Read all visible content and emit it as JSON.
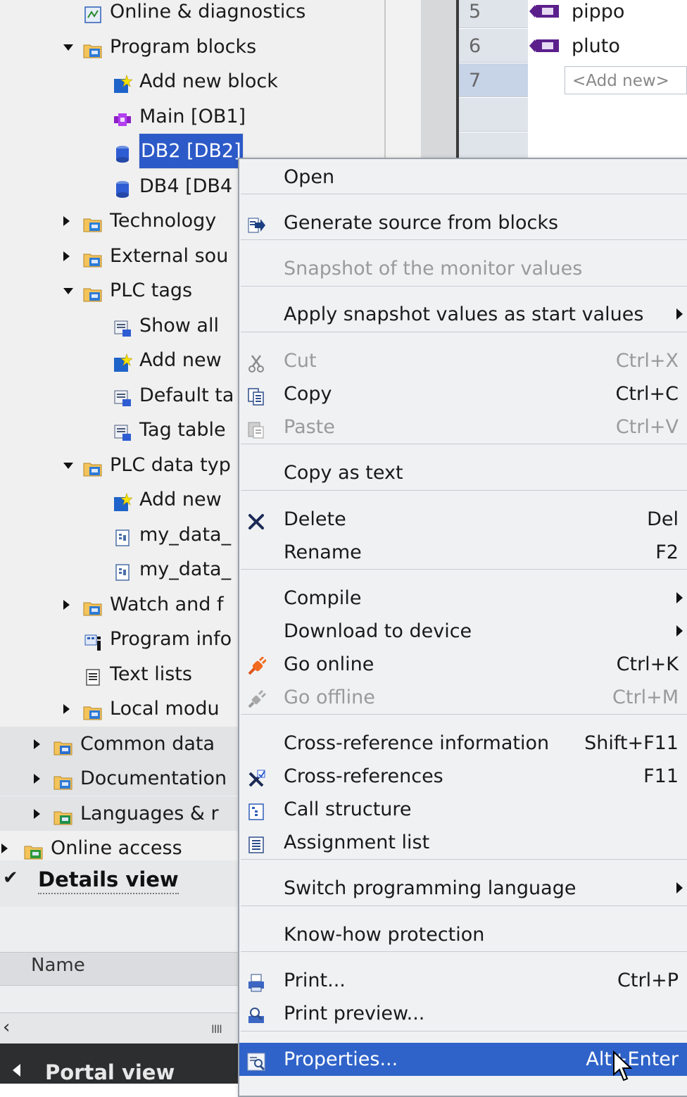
{
  "tree": {
    "items": [
      {
        "label": "Online & diagnostics",
        "icon": "diagnostics-icon",
        "level": 3,
        "expander": "none",
        "band": false
      },
      {
        "label": "Program blocks",
        "icon": "program-blocks-folder-icon",
        "level": 2,
        "expander": "expanded",
        "band": false
      },
      {
        "label": "Add new block",
        "icon": "add-new-star-icon",
        "level": 4,
        "expander": "none",
        "band": false
      },
      {
        "label": "Main [OB1]",
        "icon": "organization-block-icon",
        "level": 4,
        "expander": "none",
        "band": false
      },
      {
        "label": "DB2 [DB2]",
        "icon": "data-block-icon",
        "level": 4,
        "expander": "none",
        "band": false,
        "selected": true
      },
      {
        "label": "DB4 [DB4",
        "icon": "data-block-icon",
        "level": 4,
        "expander": "none",
        "band": false
      },
      {
        "label": "Technology",
        "icon": "technology-folder-icon",
        "level": 2,
        "expander": "collapsed",
        "band": false
      },
      {
        "label": "External sou",
        "icon": "external-source-folder-icon",
        "level": 2,
        "expander": "collapsed",
        "band": false
      },
      {
        "label": "PLC tags",
        "icon": "plc-tags-folder-icon",
        "level": 2,
        "expander": "expanded",
        "band": false
      },
      {
        "label": "Show all",
        "icon": "show-all-tags-icon",
        "level": 4,
        "expander": "none",
        "band": false
      },
      {
        "label": "Add new",
        "icon": "add-new-star-icon",
        "level": 4,
        "expander": "none",
        "band": false
      },
      {
        "label": "Default ta",
        "icon": "default-tag-table-icon",
        "level": 4,
        "expander": "none",
        "band": false
      },
      {
        "label": "Tag table",
        "icon": "tag-table-icon",
        "level": 4,
        "expander": "none",
        "band": false
      },
      {
        "label": "PLC data typ",
        "icon": "plc-data-types-folder-icon",
        "level": 2,
        "expander": "expanded",
        "band": false
      },
      {
        "label": "Add new",
        "icon": "add-new-star-icon",
        "level": 4,
        "expander": "none",
        "band": false
      },
      {
        "label": "my_data_",
        "icon": "data-type-icon",
        "level": 4,
        "expander": "none",
        "band": false
      },
      {
        "label": "my_data_",
        "icon": "data-type-icon",
        "level": 4,
        "expander": "none",
        "band": false
      },
      {
        "label": "Watch and f",
        "icon": "watch-force-folder-icon",
        "level": 2,
        "expander": "collapsed",
        "band": false
      },
      {
        "label": "Program info",
        "icon": "program-info-icon",
        "level": 3,
        "expander": "none",
        "band": false
      },
      {
        "label": "Text lists",
        "icon": "text-list-icon",
        "level": 3,
        "expander": "none",
        "band": false
      },
      {
        "label": "Local modu",
        "icon": "local-modules-folder-icon",
        "level": 2,
        "expander": "collapsed",
        "band": false
      },
      {
        "label": "Common data",
        "icon": "common-data-folder-icon",
        "level": 1,
        "expander": "collapsed",
        "band": true
      },
      {
        "label": "Documentation",
        "icon": "documentation-folder-icon",
        "level": 1,
        "expander": "collapsed",
        "band": true
      },
      {
        "label": "Languages & r",
        "icon": "languages-folder-icon",
        "level": 1,
        "expander": "collapsed",
        "band": true
      },
      {
        "label": "Online access",
        "icon": "online-access-folder-icon",
        "level": 0,
        "expander": "collapsed",
        "band": false
      }
    ]
  },
  "editor": {
    "rows": [
      {
        "num": "5",
        "name": "pippo",
        "current": false
      },
      {
        "num": "6",
        "name": "pluto",
        "current": false
      },
      {
        "num": "7",
        "name": "",
        "current": true
      }
    ],
    "add_new": "<Add new>"
  },
  "details": {
    "title": "Details view",
    "check": "✔",
    "name_column": "Name",
    "scroll_left": "‹",
    "scroll_grip": "IIII"
  },
  "portal": {
    "label": "Portal view"
  },
  "menu": {
    "items": [
      {
        "label": "Open",
        "shortcut": "",
        "icon": "",
        "disabled": false,
        "submenu": false
      },
      {
        "label": "Generate source from blocks",
        "shortcut": "",
        "icon": "generate-source-icon",
        "disabled": false,
        "submenu": false
      },
      {
        "label": "Snapshot of the monitor values",
        "shortcut": "",
        "icon": "",
        "disabled": true,
        "submenu": false
      },
      {
        "label": "Apply snapshot values as start values",
        "shortcut": "",
        "icon": "",
        "disabled": false,
        "submenu": true
      },
      {
        "label": "Cut",
        "shortcut": "Ctrl+X",
        "icon": "scissors-icon",
        "disabled": true,
        "submenu": false
      },
      {
        "label": "Copy",
        "shortcut": "Ctrl+C",
        "icon": "copy-icon",
        "disabled": false,
        "submenu": false
      },
      {
        "label": "Paste",
        "shortcut": "Ctrl+V",
        "icon": "paste-icon",
        "disabled": true,
        "submenu": false
      },
      {
        "label": "Copy as text",
        "shortcut": "",
        "icon": "",
        "disabled": false,
        "submenu": false
      },
      {
        "label": "Delete",
        "shortcut": "Del",
        "icon": "delete-x-icon",
        "disabled": false,
        "submenu": false
      },
      {
        "label": "Rename",
        "shortcut": "F2",
        "icon": "",
        "disabled": false,
        "submenu": false
      },
      {
        "label": "Compile",
        "shortcut": "",
        "icon": "",
        "disabled": false,
        "submenu": true
      },
      {
        "label": "Download to device",
        "shortcut": "",
        "icon": "",
        "disabled": false,
        "submenu": true
      },
      {
        "label": "Go online",
        "shortcut": "Ctrl+K",
        "icon": "go-online-plug-icon",
        "disabled": false,
        "submenu": false
      },
      {
        "label": "Go offline",
        "shortcut": "Ctrl+M",
        "icon": "go-offline-plug-icon",
        "disabled": true,
        "submenu": false
      },
      {
        "label": "Cross-reference information",
        "shortcut": "Shift+F11",
        "icon": "",
        "disabled": false,
        "submenu": false
      },
      {
        "label": "Cross-references",
        "shortcut": "F11",
        "icon": "cross-references-icon",
        "disabled": false,
        "submenu": false
      },
      {
        "label": "Call structure",
        "shortcut": "",
        "icon": "call-structure-icon",
        "disabled": false,
        "submenu": false
      },
      {
        "label": "Assignment list",
        "shortcut": "",
        "icon": "assignment-list-icon",
        "disabled": false,
        "submenu": false
      },
      {
        "label": "Switch programming language",
        "shortcut": "",
        "icon": "",
        "disabled": false,
        "submenu": true
      },
      {
        "label": "Know-how protection",
        "shortcut": "",
        "icon": "",
        "disabled": false,
        "submenu": false
      },
      {
        "label": "Print...",
        "shortcut": "Ctrl+P",
        "icon": "print-icon",
        "disabled": false,
        "submenu": false
      },
      {
        "label": "Print preview...",
        "shortcut": "",
        "icon": "print-preview-icon",
        "disabled": false,
        "submenu": false
      },
      {
        "label": "Properties...",
        "shortcut": "Alt+Enter",
        "icon": "properties-icon",
        "disabled": false,
        "submenu": false,
        "highlighted": true
      }
    ]
  },
  "colors": {
    "selection": "#2c5ac8",
    "menu_highlight": "#2f63c9",
    "menu_bg": "#f0f1f3",
    "portal_bar": "#2d2e30",
    "tag_icon": "#5b1f8c"
  }
}
